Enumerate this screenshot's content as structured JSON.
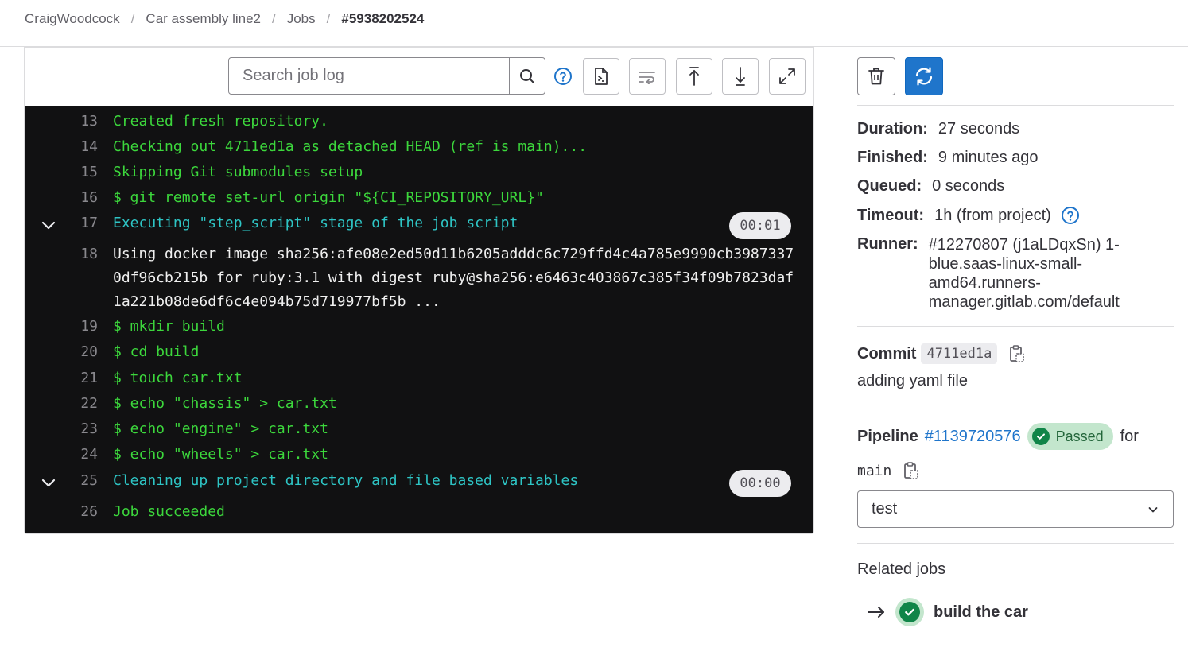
{
  "breadcrumb": {
    "items": [
      "CraigWoodcock",
      "Car assembly line2",
      "Jobs"
    ],
    "current": "#5938202524",
    "separator": "/"
  },
  "log_toolbar": {
    "search_placeholder": "Search job log",
    "icons": [
      "search-icon",
      "question-icon",
      "raw-log-icon",
      "line-wrap-icon",
      "scroll-top-icon",
      "scroll-bottom-icon",
      "fullscreen-icon"
    ]
  },
  "log": {
    "lines": [
      {
        "num": "13",
        "text": "Created fresh repository.",
        "color": "green"
      },
      {
        "num": "14",
        "text": "Checking out 4711ed1a as detached HEAD (ref is main)...",
        "color": "green"
      },
      {
        "num": "15",
        "text": "Skipping Git submodules setup",
        "color": "green"
      },
      {
        "num": "16",
        "text": "$ git remote set-url origin \"${CI_REPOSITORY_URL}\"",
        "color": "green"
      },
      {
        "num": "17",
        "text": "Executing \"step_script\" stage of the job script",
        "color": "cyan",
        "duration": "00:01"
      },
      {
        "num": "18",
        "text": "Using docker image sha256:afe08e2ed50d11b6205adddc6c729ffd4c4a785e9990cb39873370df96cb215b for ruby:3.1 with digest ruby@sha256:e6463c403867c385f34f09b7823daf1a221b08de6df6c4e094b75d719977bf5b ...",
        "color": "white"
      },
      {
        "num": "19",
        "text": "$ mkdir build",
        "color": "green"
      },
      {
        "num": "20",
        "text": "$ cd build",
        "color": "green"
      },
      {
        "num": "21",
        "text": "$ touch car.txt",
        "color": "green"
      },
      {
        "num": "22",
        "text": "$ echo \"chassis\" > car.txt",
        "color": "green"
      },
      {
        "num": "23",
        "text": "$ echo \"engine\" > car.txt",
        "color": "green"
      },
      {
        "num": "24",
        "text": "$ echo \"wheels\" > car.txt",
        "color": "green"
      },
      {
        "num": "25",
        "text": "Cleaning up project directory and file based variables",
        "color": "cyan",
        "duration": "00:00"
      },
      {
        "num": "26",
        "text": "Job succeeded",
        "color": "green"
      }
    ]
  },
  "sidebar": {
    "meta": {
      "duration_label": "Duration:",
      "duration_value": "27 seconds",
      "finished_label": "Finished:",
      "finished_value": "9 minutes ago",
      "queued_label": "Queued:",
      "queued_value": "0 seconds",
      "timeout_label": "Timeout:",
      "timeout_value": "1h (from project)",
      "runner_label": "Runner:",
      "runner_value": "#12270807 (j1aLDqxSn) 1-blue.saas-linux-small-amd64.runners-manager.gitlab.com/default"
    },
    "commit": {
      "label": "Commit",
      "sha": "4711ed1a",
      "message": "adding yaml file"
    },
    "pipeline": {
      "label": "Pipeline",
      "id": "#1139720576",
      "status": "Passed",
      "for_text": "for",
      "branch": "main"
    },
    "stage_select": {
      "value": "test"
    },
    "related": {
      "title": "Related jobs",
      "jobs": [
        {
          "name": "build the car"
        }
      ]
    }
  },
  "colors": {
    "log_green": "#3cd73c",
    "log_cyan": "#2ec5c5",
    "log_bg": "#111112",
    "primary_blue": "#1f75cb",
    "success_green": "#108548"
  }
}
